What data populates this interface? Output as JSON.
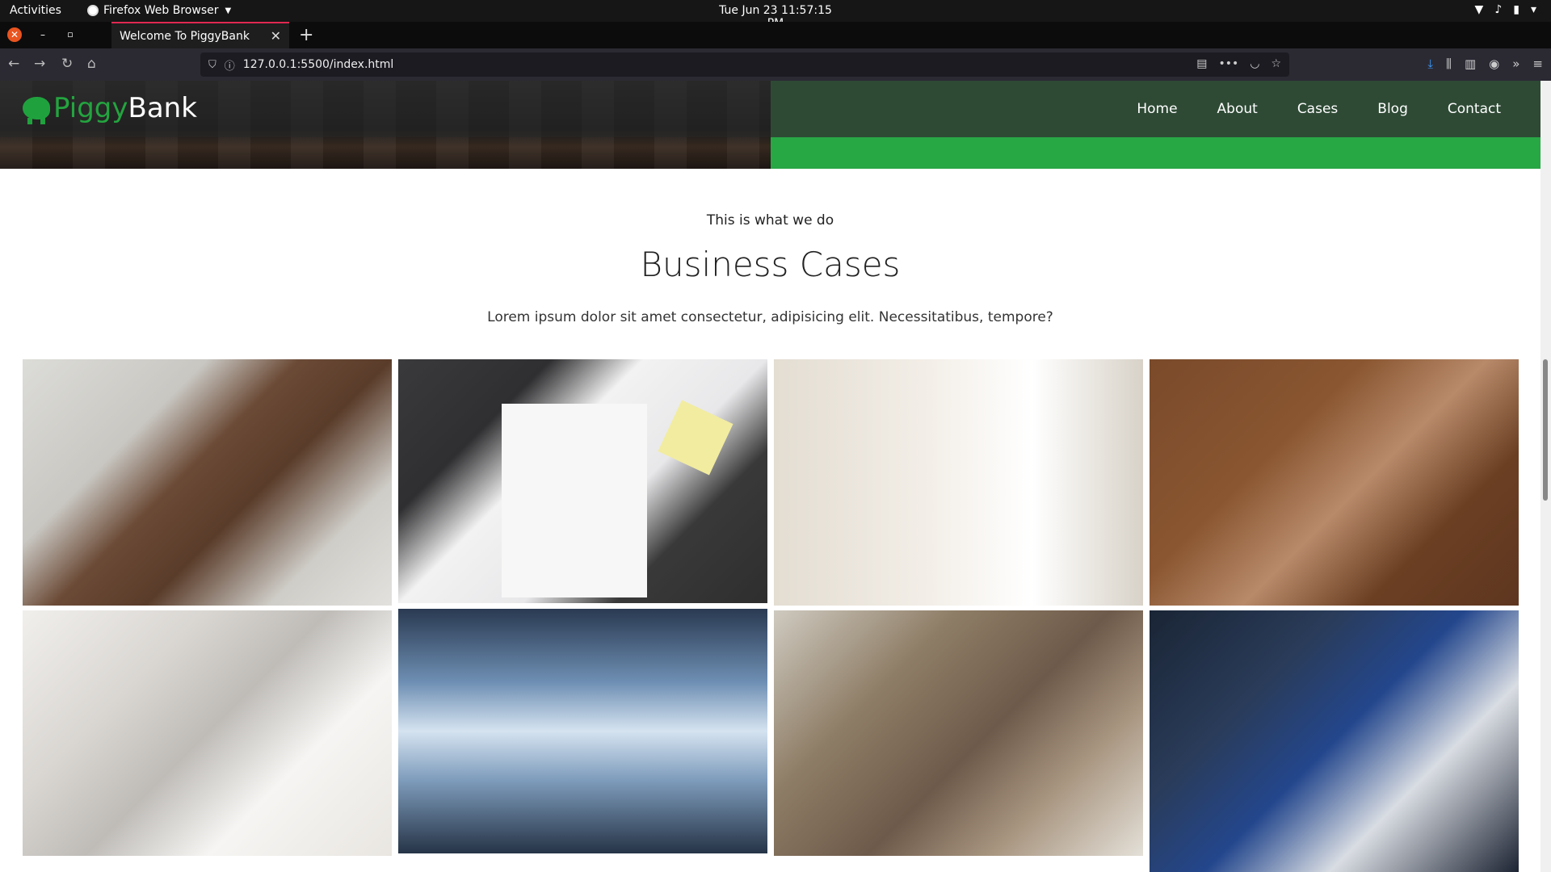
{
  "system": {
    "activities": "Activities",
    "app_name": "Firefox Web Browser",
    "clock": "Tue Jun 23  11:57:15 PM"
  },
  "browser": {
    "tab_title": "Welcome To PiggyBank",
    "url": "127.0.0.1:5500/index.html"
  },
  "site": {
    "logo_part1": "Piggy",
    "logo_part2": "Bank",
    "nav": [
      "Home",
      "About",
      "Cases",
      "Blog",
      "Contact"
    ]
  },
  "section": {
    "eyebrow": "This is what we do",
    "heading": "Business Cases",
    "lead": "Lorem ipsum dolor sit amet consectetur, adipisicing elit. Necessitatibus, tempore?"
  },
  "colors": {
    "brand_green": "#28a745",
    "nav_dark_green": "#2e4a35"
  },
  "gallery": [
    {
      "name": "photo-team-meeting-table"
    },
    {
      "name": "photo-charts-laptop-desk"
    },
    {
      "name": "photo-handshake"
    },
    {
      "name": "photo-team-hands-stacked"
    },
    {
      "name": "photo-laptop-typing"
    },
    {
      "name": "photo-skyscrapers"
    },
    {
      "name": "photo-office-woman-glasses"
    },
    {
      "name": "photo-smiling-colleagues"
    }
  ]
}
